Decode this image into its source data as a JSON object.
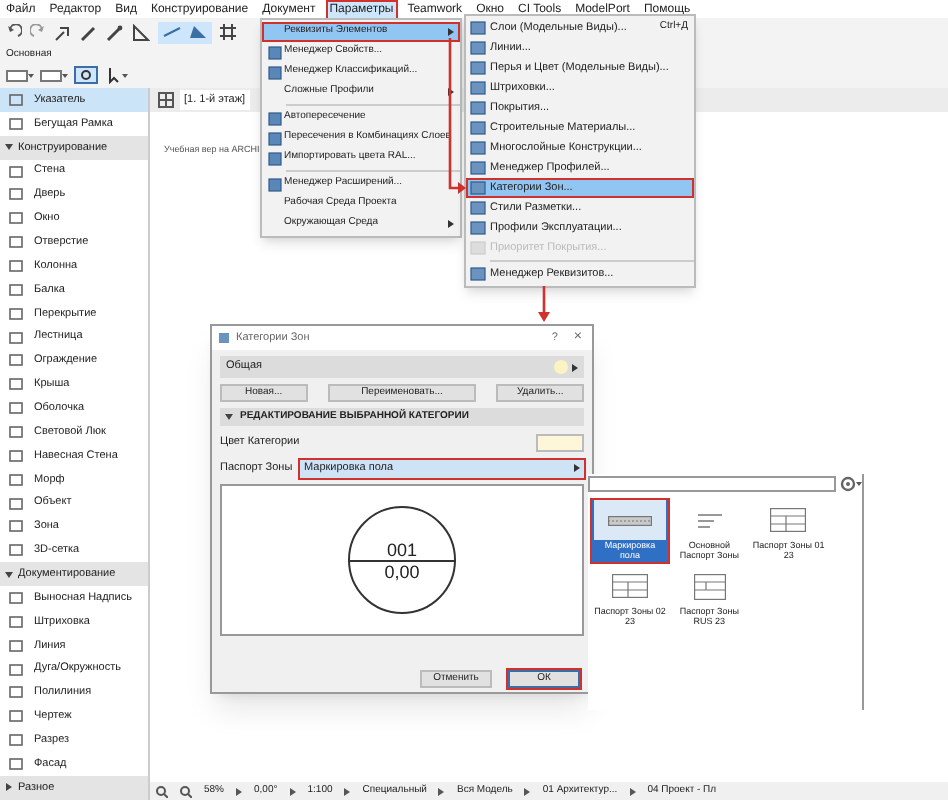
{
  "menu_bar": [
    {
      "label": "Файл",
      "selected": false,
      "highlighted": false
    },
    {
      "label": "Редактор",
      "selected": false,
      "highlighted": false
    },
    {
      "label": "Вид",
      "selected": false,
      "highlighted": false
    },
    {
      "label": "Конструирование",
      "selected": false,
      "highlighted": false
    },
    {
      "label": "Документ",
      "selected": false,
      "highlighted": false
    },
    {
      "label": "Параметры",
      "selected": true,
      "highlighted": true
    },
    {
      "label": "Teamwork",
      "selected": false,
      "highlighted": false
    },
    {
      "label": "Окно",
      "selected": false,
      "highlighted": false
    },
    {
      "label": "CI Tools",
      "selected": false,
      "highlighted": false
    },
    {
      "label": "ModelPort",
      "selected": false,
      "highlighted": false
    },
    {
      "label": "Помощь",
      "selected": false,
      "highlighted": false
    }
  ],
  "toolbar_label": "Основная",
  "toolbox": {
    "items": [
      {
        "label": "Указатель",
        "selected": true
      },
      {
        "label": "Бегущая Рамка",
        "selected": false
      }
    ],
    "sections": [
      {
        "title": "Конструирование",
        "expanded": true,
        "items": [
          {
            "label": "Стена",
            "selected": false
          },
          {
            "label": "Дверь",
            "selected": false
          },
          {
            "label": "Окно",
            "selected": false
          },
          {
            "label": "Отверстие",
            "selected": false
          },
          {
            "label": "Колонна",
            "selected": false
          },
          {
            "label": "Балка",
            "selected": false
          },
          {
            "label": "Перекрытие",
            "selected": false
          },
          {
            "label": "Лестница",
            "selected": false
          },
          {
            "label": "Ограждение",
            "selected": false
          },
          {
            "label": "Крыша",
            "selected": false
          },
          {
            "label": "Оболочка",
            "selected": false
          },
          {
            "label": "Световой Люк",
            "selected": false
          },
          {
            "label": "Навесная Стена",
            "selected": false
          },
          {
            "label": "Морф",
            "selected": false
          },
          {
            "label": "Объект",
            "selected": false
          },
          {
            "label": "Зона",
            "selected": false
          },
          {
            "label": "3D-сетка",
            "selected": false
          }
        ]
      },
      {
        "title": "Документирование",
        "expanded": true,
        "items": [
          {
            "label": "Выносная Надпись",
            "selected": false
          },
          {
            "label": "Штриховка",
            "selected": false
          },
          {
            "label": "Линия",
            "selected": false
          },
          {
            "label": "Дуга/Окружность",
            "selected": false
          },
          {
            "label": "Полилиния",
            "selected": false
          },
          {
            "label": "Чертеж",
            "selected": false
          },
          {
            "label": "Разрез",
            "selected": false
          },
          {
            "label": "Фасад",
            "selected": false
          }
        ]
      },
      {
        "title": "Разное",
        "expanded": false
      }
    ]
  },
  "view_tab": {
    "label": "[1. 1-й этаж]"
  },
  "canvas_text": "Учебная вер на ARCHI",
  "options_menu": [
    {
      "kind": "item",
      "label": "Реквизиты Элементов",
      "icon": false,
      "submenu": true,
      "highlighted": true
    },
    {
      "kind": "item",
      "label": "Менеджер Свойств...",
      "icon": true,
      "submenu": false,
      "highlighted": false
    },
    {
      "kind": "item",
      "label": "Менеджер Классификаций...",
      "icon": true,
      "submenu": false,
      "highlighted": false
    },
    {
      "kind": "item",
      "label": "Сложные Профили",
      "icon": false,
      "submenu": true,
      "highlighted": false
    },
    {
      "kind": "separator"
    },
    {
      "kind": "item",
      "label": "Автопересечение",
      "icon": true,
      "submenu": false,
      "highlighted": false
    },
    {
      "kind": "item",
      "label": "Пересечения в Комбинациях Слоев",
      "icon": true,
      "submenu": false,
      "highlighted": false
    },
    {
      "kind": "item",
      "label": "Импортировать цвета RAL...",
      "icon": true,
      "submenu": false,
      "highlighted": false
    },
    {
      "kind": "separator"
    },
    {
      "kind": "item",
      "label": "Менеджер Расширений...",
      "icon": true,
      "submenu": false,
      "highlighted": false
    },
    {
      "kind": "item",
      "label": "Рабочая Среда Проекта",
      "icon": false,
      "submenu": false,
      "highlighted": false
    },
    {
      "kind": "item",
      "label": "Окружающая Среда",
      "icon": false,
      "submenu": true,
      "highlighted": false
    }
  ],
  "attributes_submenu": [
    {
      "kind": "item",
      "label": "Слои (Модельные Виды)...",
      "shortcut": "Ctrl+Д",
      "disabled": false,
      "highlighted": false
    },
    {
      "kind": "item",
      "label": "Линии...",
      "disabled": false,
      "highlighted": false
    },
    {
      "kind": "item",
      "label": "Перья и Цвет (Модельные Виды)...",
      "disabled": false,
      "highlighted": false
    },
    {
      "kind": "item",
      "label": "Штриховки...",
      "disabled": false,
      "highlighted": false
    },
    {
      "kind": "item",
      "label": "Покрытия...",
      "disabled": false,
      "highlighted": false
    },
    {
      "kind": "item",
      "label": "Строительные Материалы...",
      "disabled": false,
      "highlighted": false
    },
    {
      "kind": "item",
      "label": "Многослойные Конструкции...",
      "disabled": false,
      "highlighted": false
    },
    {
      "kind": "item",
      "label": "Менеджер Профилей...",
      "disabled": false,
      "highlighted": false
    },
    {
      "kind": "item",
      "label": "Категории Зон...",
      "disabled": false,
      "highlighted": true
    },
    {
      "kind": "item",
      "label": "Стили Разметки...",
      "disabled": false,
      "highlighted": false
    },
    {
      "kind": "item",
      "label": "Профили Эксплуатации...",
      "disabled": false,
      "highlighted": false
    },
    {
      "kind": "item",
      "label": "Приоритет Покрытия...",
      "disabled": true,
      "highlighted": false
    },
    {
      "kind": "separator"
    },
    {
      "kind": "item",
      "label": "Менеджер Реквизитов...",
      "disabled": false,
      "highlighted": false
    }
  ],
  "dialog": {
    "title": "Категории Зон",
    "help": "?",
    "close": "×",
    "category": {
      "label": "Общая",
      "color": "#fbf3c4"
    },
    "buttons": [
      "Новая...",
      "Переименовать...",
      "Удалить..."
    ],
    "section": {
      "title": "РЕДАКТИРОВАНИЕ ВЫБРАННОЙ КАТЕГОРИИ",
      "expanded": true
    },
    "color_label": "Цвет Категории",
    "stamp_label": "Паспорт Зоны",
    "stamp_value": "Маркировка пола",
    "stamp_highlighted": true,
    "preview": {
      "number": "001",
      "area": "0,00"
    },
    "cancel": "Отменить",
    "ok": "ОК",
    "ok_highlighted": true
  },
  "stamp_picker": {
    "stamps": [
      {
        "label": "Маркировка пола",
        "selected": true,
        "kind": "floor"
      },
      {
        "label": "Основной Паспорт Зоны",
        "selected": false,
        "kind": "basic"
      },
      {
        "label": "Паспорт Зоны 01 23",
        "selected": false,
        "kind": "table"
      },
      {
        "label": "Паспорт Зоны 02 23",
        "selected": false,
        "kind": "table"
      },
      {
        "label": "Паспорт Зоны RUS 23",
        "selected": false,
        "kind": "rus"
      }
    ]
  },
  "status_bar": [
    "58%",
    "0,00°",
    "1:100",
    "Специальный",
    "Вся Модель",
    "01 Архитектур...",
    "04 Проект - Пл"
  ]
}
